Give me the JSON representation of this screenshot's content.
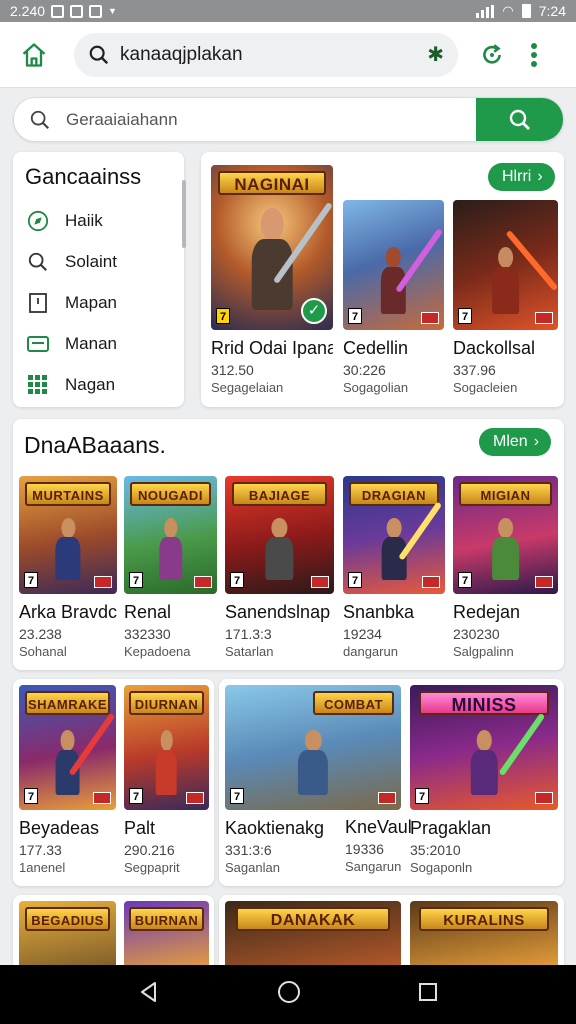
{
  "status_bar": {
    "time_left": "2.240",
    "time_right": "7:24"
  },
  "top_bar": {
    "url_text": "kanaaqjplakan"
  },
  "search": {
    "placeholder": "Geraaiaiahann"
  },
  "category_panel": {
    "title": "Gancaainss",
    "items": [
      {
        "label": "Haiik",
        "icon": "compass-icon"
      },
      {
        "label": "Solaint",
        "icon": "search-icon"
      },
      {
        "label": "Mapan",
        "icon": "clipboard-icon"
      },
      {
        "label": "Manan",
        "icon": "folder-icon"
      },
      {
        "label": "Nagan",
        "icon": "grid-icon"
      }
    ]
  },
  "featured": {
    "more_label": "Hlrri",
    "games": [
      {
        "banner": "NAGINAI",
        "name": "Rrid Odai Ipana'",
        "count": "312.50",
        "sub": "Segagelaian"
      },
      {
        "banner": "",
        "name": "Cedellin",
        "count": "30:226",
        "sub": "Sogagolian"
      },
      {
        "banner": "",
        "name": "Dackollsal",
        "count": "337.96",
        "sub": "Sogacleien"
      }
    ]
  },
  "section2": {
    "title": "DnaABaaans.",
    "more_label": "Mlen",
    "games": [
      {
        "banner": "MURTAINS",
        "name": "Arka Bravdc",
        "count": "23.238",
        "sub": "Sohanal"
      },
      {
        "banner": "NOUGADI",
        "name": "Renal",
        "count": "332330",
        "sub": "Kepadoena"
      },
      {
        "banner": "BAJIAGE",
        "name": "Sanendslnap",
        "count": "171.3:3",
        "sub": "Satarlan"
      },
      {
        "banner": "DRAGIAN",
        "name": "Snanbka",
        "count": "19234",
        "sub": "dangarun"
      },
      {
        "banner": "MIGIAN",
        "name": "Redejan",
        "count": "230230",
        "sub": "Salgpalinn"
      }
    ]
  },
  "section3": {
    "games": [
      {
        "banner": "SHAMRAKE",
        "name": "Beyadeas",
        "count": "177.33",
        "sub": "1anenel"
      },
      {
        "banner": "DIURNAN",
        "name": "Palt",
        "count": "290.216",
        "sub": "Segpaprit"
      },
      {
        "banner": "COMBAT",
        "name": "Kaoktienakg",
        "count": "331:3:6",
        "sub": "Saganlan"
      },
      {
        "banner": "",
        "name": "KneVaulkine",
        "count": "19336",
        "sub": "Sangarun"
      },
      {
        "banner": "MINISS",
        "name": "Pragaklan",
        "count": "35:2010",
        "sub": "Sogaponln"
      }
    ]
  },
  "section4": {
    "games": [
      {
        "banner": "BEGADIUS"
      },
      {
        "banner": "BUIRNAN"
      },
      {
        "banner": "DANAKAK"
      },
      {
        "banner": "KURALINS"
      }
    ]
  },
  "colors": {
    "accent": "#1e9a4a",
    "background": "#eceef0"
  }
}
